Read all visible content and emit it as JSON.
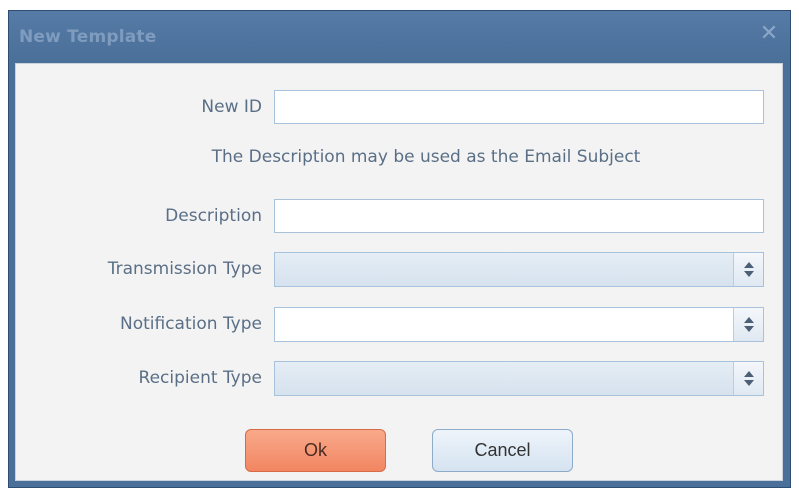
{
  "window": {
    "title": "New Template",
    "close_glyph": "✕"
  },
  "form": {
    "new_id_label": "New ID",
    "new_id_value": "",
    "info_text": "The Description may be used as the Email Subject",
    "description_label": "Description",
    "description_value": "",
    "transmission_type_label": "Transmission Type",
    "transmission_type_value": "",
    "notification_type_label": "Notification Type",
    "notification_type_value": "",
    "recipient_type_label": "Recipient Type",
    "recipient_type_value": ""
  },
  "buttons": {
    "ok": "Ok",
    "cancel": "Cancel"
  },
  "colors": {
    "titlebar": "#4a6f99",
    "ok_button": "#f28662",
    "label_text": "#5a6f86"
  },
  "icons": {
    "close": "close-icon",
    "spinner": "updown-spinner-icon"
  }
}
